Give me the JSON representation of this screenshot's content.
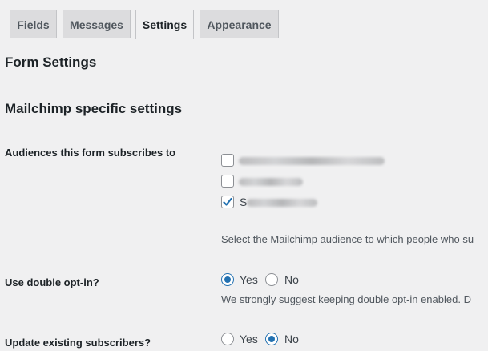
{
  "tabs": [
    {
      "label": "Fields",
      "active": false
    },
    {
      "label": "Messages",
      "active": false
    },
    {
      "label": "Settings",
      "active": true
    },
    {
      "label": "Appearance",
      "active": false
    }
  ],
  "sections": {
    "form_settings_title": "Form Settings",
    "mailchimp_title": "Mailchimp specific settings"
  },
  "audiences": {
    "label": "Audiences this form subscribes to",
    "items": [
      {
        "checked": false,
        "visible_prefix": ""
      },
      {
        "checked": false,
        "visible_prefix": ""
      },
      {
        "checked": true,
        "visible_prefix": "S"
      }
    ],
    "description": "Select the Mailchimp audience to which people who su"
  },
  "double_optin": {
    "label": "Use double opt-in?",
    "yes_label": "Yes",
    "no_label": "No",
    "selected": "Yes",
    "description": "We strongly suggest keeping double opt-in enabled. D"
  },
  "update_existing": {
    "label": "Update existing subscribers?",
    "yes_label": "Yes",
    "no_label": "No",
    "selected": "No"
  },
  "colors": {
    "accent": "#2271b1",
    "background": "#f0f0f1",
    "tab_inactive": "#dcdcde",
    "border": "#c3c4c7"
  }
}
